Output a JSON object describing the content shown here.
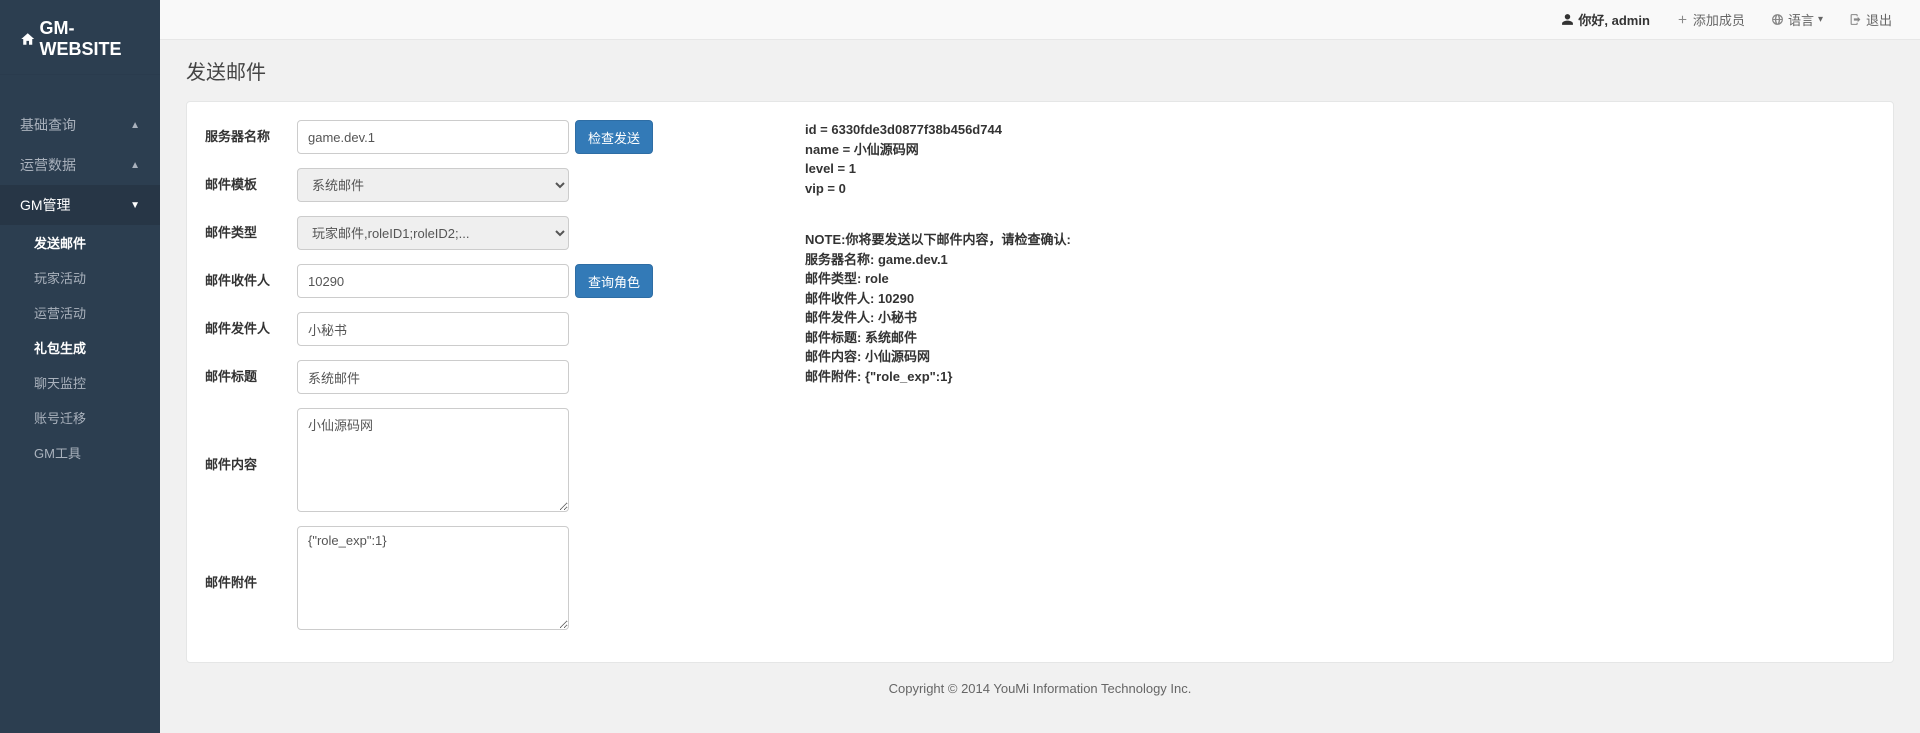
{
  "brand": "GM-WEBSITE",
  "sidebar": {
    "groups": [
      {
        "label": "基础查询",
        "expanded": false
      },
      {
        "label": "运营数据",
        "expanded": false
      },
      {
        "label": "GM管理",
        "expanded": true
      }
    ],
    "subitems": [
      {
        "label": "发送邮件",
        "active": true
      },
      {
        "label": "玩家活动",
        "active": false
      },
      {
        "label": "运营活动",
        "active": false
      },
      {
        "label": "礼包生成",
        "active": true
      },
      {
        "label": "聊天监控",
        "active": false
      },
      {
        "label": "账号迁移",
        "active": false
      },
      {
        "label": "GM工具",
        "active": false
      }
    ]
  },
  "topbar": {
    "greeting": "你好, admin",
    "add_member": "添加成员",
    "language": "语言",
    "logout": "退出"
  },
  "page_title": "发送邮件",
  "form": {
    "server_label": "服务器名称",
    "server_value": "game.dev.1",
    "check_send_btn": "检查发送",
    "template_label": "邮件模板",
    "template_value": "系统邮件",
    "type_label": "邮件类型",
    "type_value": "玩家邮件,roleID1;roleID2;...",
    "recipient_label": "邮件收件人",
    "recipient_value": "10290",
    "query_role_btn": "查询角色",
    "sender_label": "邮件发件人",
    "sender_value": "小秘书",
    "title_label": "邮件标题",
    "title_value": "系统邮件",
    "content_label": "邮件内容",
    "content_value": "小仙源码网",
    "attach_label": "邮件附件",
    "attach_value": "{\"role_exp\":1}"
  },
  "info": {
    "id_line": "id = 6330fde3d0877f38b456d744",
    "name_line": "name = 小仙源码网",
    "level_line": "level = 1",
    "vip_line": "vip = 0",
    "note": "NOTE:你将要发送以下邮件内容，请检查确认:",
    "l1": "服务器名称: game.dev.1",
    "l2": "邮件类型: role",
    "l3": "邮件收件人: 10290",
    "l4": "邮件发件人: 小秘书",
    "l5": "邮件标题: 系统邮件",
    "l6": "邮件内容: 小仙源码网",
    "l7": "邮件附件: {\"role_exp\":1}"
  },
  "footer": "Copyright © 2014 YouMi Information Technology Inc."
}
